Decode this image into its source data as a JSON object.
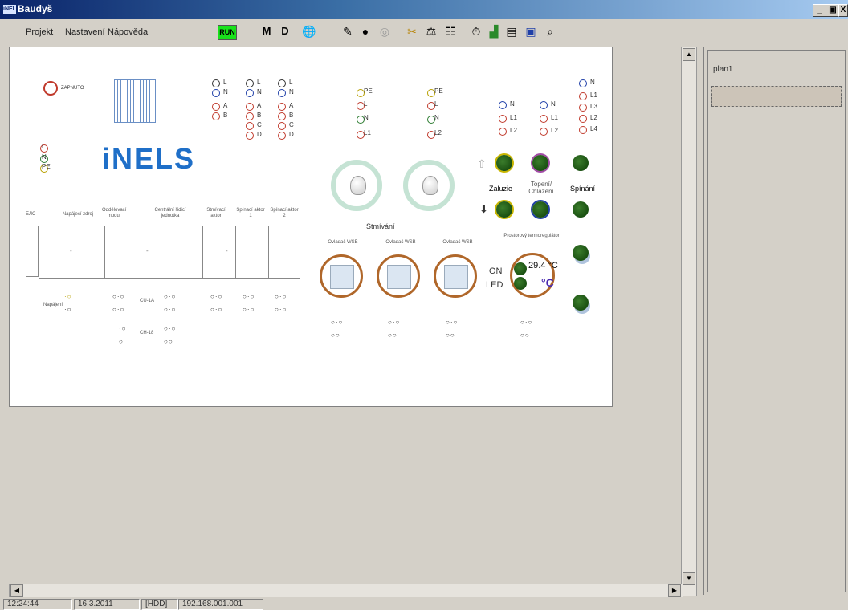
{
  "window": {
    "title": "Baudyš",
    "app_badge": "iNELS"
  },
  "window_buttons": {
    "minimize": "_",
    "restore": "▣",
    "close": "X"
  },
  "menu": {
    "items": [
      "Projekt",
      "Nastavení",
      "Nápověda"
    ]
  },
  "toolbar": {
    "run_label": "RUN",
    "m_label": "M",
    "d_label": "D"
  },
  "canvas": {
    "status_led_label": "ZAPNUTO",
    "logo_text": "iNELS",
    "left_leds": [
      "L",
      "N",
      "PE"
    ],
    "module_leds": {
      "col1": [
        "L",
        "N",
        "A",
        "B"
      ],
      "col2": [
        "L",
        "N",
        "A",
        "B",
        "C",
        "D"
      ],
      "col3": [
        "L",
        "N",
        "A",
        "B",
        "C",
        "D"
      ]
    },
    "supply_leds_1": [
      "PE",
      "L",
      "N",
      "L1"
    ],
    "supply_leds_2": [
      "PE",
      "L",
      "N",
      "L2"
    ],
    "pair_leds_1": [
      "N",
      "L1",
      "L2"
    ],
    "pair_leds_2": [
      "N",
      "L1",
      "L2"
    ],
    "right_leds": [
      "N",
      "L1",
      "L3",
      "L2",
      "L4"
    ],
    "module_headers": [
      "Napájecí zdroj",
      "Oddělovací modul",
      "Centrální řídicí jednotka",
      "Stmívací aktor",
      "Spínací aktor 1",
      "Spínací aktor 2"
    ],
    "left_header": "ЕЛС",
    "dimming_label": "Stmívání",
    "zaluzie_label": "Žaluzie",
    "topeni_label": "Topení/ Chlazení",
    "spinani_label": "Spínání",
    "wsb_labels": [
      "Ovladač WSB",
      "Ovladač WSB",
      "Ovladač WSB"
    ],
    "termo_label": "Prostorový termoregulátor",
    "on_label": "ON",
    "led_label": "LED",
    "temperature": "29.4 °C",
    "temp_unit": "°C",
    "napajeni_label": "Napájení",
    "cu_label": "CU-1A",
    "cu2_label": "CH-18",
    "dash": "-"
  },
  "right_panel": {
    "plan_label": "plan1"
  },
  "status": {
    "time": "12:24:44",
    "date": "16.3.2011",
    "mode": "[HDD]",
    "ip": "192.168.001.001"
  }
}
